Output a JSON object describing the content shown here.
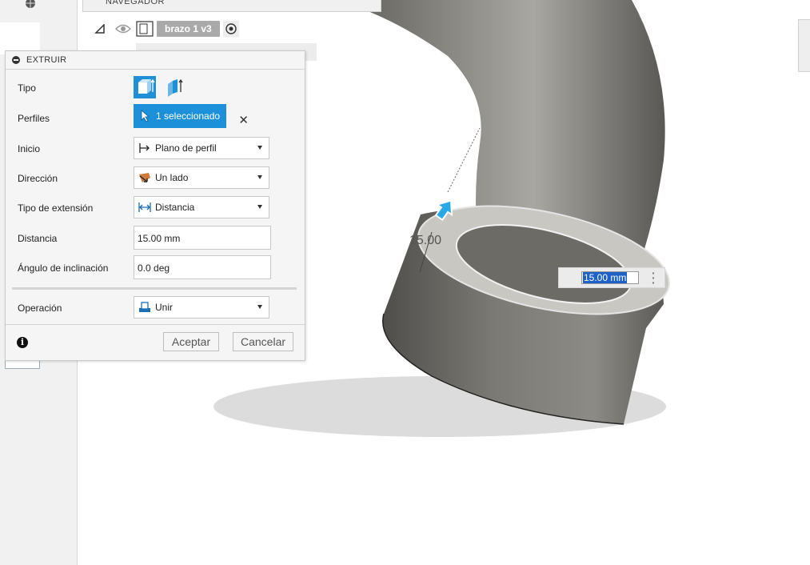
{
  "navigator": {
    "title": "NAVEGADOR",
    "component_name": "brazo 1 v3"
  },
  "extrude": {
    "title": "EXTRUIR",
    "rows": {
      "tipo": {
        "label": "Tipo"
      },
      "perfiles": {
        "label": "Perfiles",
        "value": "1 seleccionado"
      },
      "inicio": {
        "label": "Inicio",
        "value": "Plano de perfil"
      },
      "direccion": {
        "label": "Dirección",
        "value": "Un lado"
      },
      "tipo_extension": {
        "label": "Tipo de extensión",
        "value": "Distancia"
      },
      "distancia": {
        "label": "Distancia",
        "value": "15.00 mm"
      },
      "angulo": {
        "label": "Ángulo de inclinación",
        "value": "0.0 deg"
      },
      "operacion": {
        "label": "Operación",
        "value": "Unir"
      }
    },
    "buttons": {
      "ok": "Aceptar",
      "cancel": "Cancelar"
    }
  },
  "viewport": {
    "dimension_input_value": "15.00 mm",
    "dimension_label": "15.00"
  },
  "colors": {
    "accent": "#1c90d8",
    "model_gray": "#6d6b66",
    "panel_bg": "#f5f5f5"
  },
  "icons": [
    "globe-icon",
    "triangle-expand-icon",
    "eye-icon",
    "component-box-icon",
    "radio-target-icon",
    "collapse-icon",
    "extrude-solid-icon",
    "extrude-surface-icon",
    "cursor-select-icon",
    "clear-x-icon",
    "profile-plane-icon",
    "direction-icon",
    "distance-icon",
    "join-icon",
    "info-icon",
    "drag-arrow-icon",
    "menu-dots-icon"
  ]
}
